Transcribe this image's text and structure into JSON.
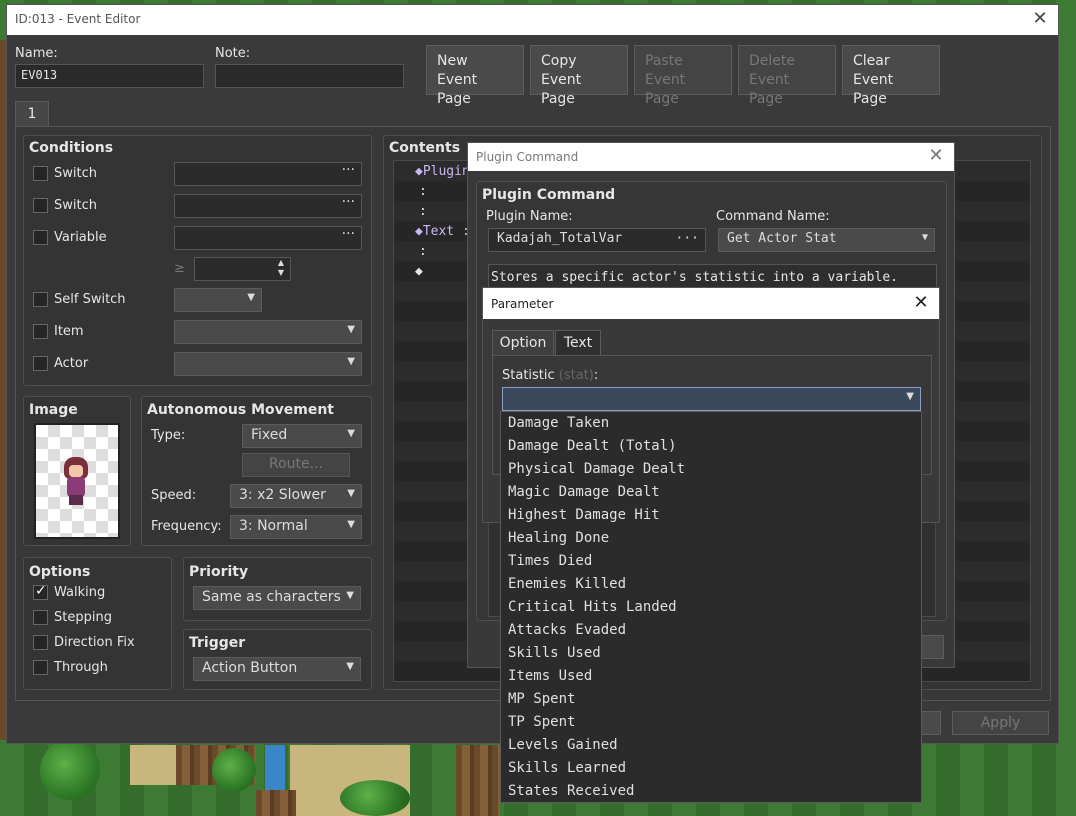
{
  "event_editor": {
    "title": "ID:013 - Event Editor",
    "name_label": "Name:",
    "name_value": "EV013",
    "note_label": "Note:",
    "note_value": "",
    "buttons": {
      "new": [
        "New",
        "Event Page"
      ],
      "copy": [
        "Copy",
        "Event Page"
      ],
      "paste": [
        "Paste",
        "Event Page"
      ],
      "delete": [
        "Delete",
        "Event Page"
      ],
      "clear": [
        "Clear",
        "Event Page"
      ]
    },
    "page_tab": "1",
    "conditions": {
      "title": "Conditions",
      "switch1": "Switch",
      "switch2": "Switch",
      "variable": "Variable",
      "ge": "≥",
      "self_switch": "Self Switch",
      "item": "Item",
      "actor": "Actor"
    },
    "image": {
      "title": "Image"
    },
    "autonomous": {
      "title": "Autonomous Movement",
      "type_label": "Type:",
      "type_value": "Fixed",
      "route_btn": "Route...",
      "speed_label": "Speed:",
      "speed_value": "3: x2 Slower",
      "freq_label": "Frequency:",
      "freq_value": "3: Normal"
    },
    "options": {
      "title": "Options",
      "walking": "Walking",
      "stepping": "Stepping",
      "direction_fix": "Direction Fix",
      "through": "Through"
    },
    "priority": {
      "title": "Priority",
      "value": "Same as characters"
    },
    "trigger": {
      "title": "Trigger",
      "value": "Action Button"
    },
    "contents": {
      "title": "Contents",
      "lines": [
        "◆Plugin",
        ":",
        ":",
        "◆Text :",
        ":     :",
        "◆"
      ]
    },
    "apply": "Apply"
  },
  "plugin_command": {
    "title": "Plugin Command",
    "group_title": "Plugin Command",
    "plugin_name_label": "Plugin Name:",
    "plugin_name_value": "Kadajah_TotalVar",
    "command_name_label": "Command Name:",
    "command_name_value": "Get Actor Stat",
    "description": "Stores a specific actor's statistic into a variable."
  },
  "parameter": {
    "title": "Parameter",
    "tabs": [
      "Option",
      "Text"
    ],
    "stat_label": "Statistic",
    "stat_key": "(stat)",
    "stat_colon": ":",
    "selected": "",
    "options": [
      "Damage Taken",
      "Damage Dealt (Total)",
      "Physical Damage Dealt",
      "Magic Damage Dealt",
      "Highest Damage Hit",
      "Healing Done",
      "Times Died",
      "Enemies Killed",
      "Critical Hits Landed",
      "Attacks Evaded",
      "Skills Used",
      "Items Used",
      "MP Spent",
      "TP Spent",
      "Levels Gained",
      "Skills Learned",
      "States Received"
    ]
  }
}
